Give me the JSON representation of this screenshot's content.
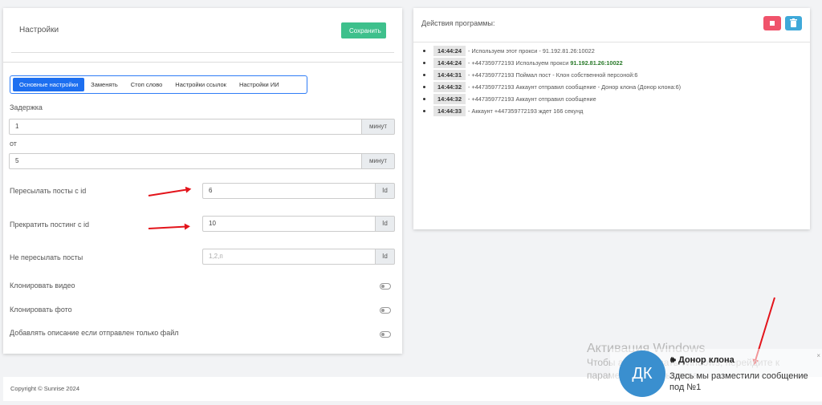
{
  "settings": {
    "title": "Настройки",
    "save_label": "Сохранить",
    "tabs": [
      "Основные настройки",
      "Заменять",
      "Стоп слово",
      "Настройки ссылок",
      "Настройки ИИ"
    ],
    "delay_label": "Задержка",
    "delay_value": "1",
    "delay_unit": "минут",
    "from_label": "от",
    "from_value": "5",
    "from_unit": "минут",
    "forward_label": "Пересылать посты с id",
    "forward_value": "6",
    "forward_addon": "Id",
    "stop_label": "Прекратить постинг с id",
    "stop_value": "10",
    "stop_addon": "Id",
    "skip_label": "Не пересылать посты",
    "skip_placeholder": "1,2,п",
    "skip_addon": "Id",
    "clone_video_label": "Клонировать видео",
    "clone_photo_label": "Клонировать фото",
    "add_desc_label": "Добавлять описание если отправлен только файл"
  },
  "log": {
    "title": "Действия программы:",
    "rows": [
      {
        "time": "14:44:24",
        "text": "- Используем этот прокси - 91.192.81.26:10022",
        "extra": ""
      },
      {
        "time": "14:44:24",
        "text": "- +447359772193 Используем прокси",
        "extra": "91.192.81.26:10022"
      },
      {
        "time": "14:44:31",
        "text": "- +447359772193 Поймал пост - Клон собственной персоной:6",
        "extra": ""
      },
      {
        "time": "14:44:32",
        "text": "- +447359772193 Аккаунт отправил сообщение - Донор клона (Донор клона:6)",
        "extra": ""
      },
      {
        "time": "14:44:32",
        "text": "- +447359772193 Аккаунт отправил сообщение",
        "extra": ""
      },
      {
        "time": "14:44:33",
        "text": "- Аккаунт +447359772193 ждет 166 секунд",
        "extra": ""
      }
    ]
  },
  "footer": {
    "copyright": "Copyright © Sunrise 2024"
  },
  "watermark": {
    "title": "Активация Windows",
    "line1": "Чтобы активировать Windows, перейдите к",
    "line2": "параметрам компьютера."
  },
  "toast": {
    "avatar": "ДК",
    "title": "🕪 Донор клона",
    "body": "Здесь мы разместили сообщение под №1",
    "close": "×"
  },
  "colors": {
    "save_button": "#3ec08c",
    "active_tab": "#1d6ff0",
    "stop_button": "#f0536b",
    "trash_button": "#3fa9d9",
    "annotation_arrow": "#e3141b",
    "avatar": "#3a8fcf"
  }
}
